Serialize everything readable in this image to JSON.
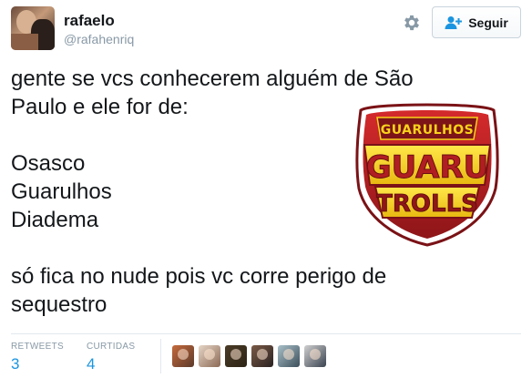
{
  "header": {
    "fullname": "rafaelo",
    "username": "@rafahenriq",
    "follow_label": "Seguir"
  },
  "tweet": {
    "text": "gente se vcs conhecerem alguém de São\nPaulo e ele for de:\n\nOsasco\nGuarulhos\nDiadema\n\nsó fica no nude pois vc corre perigo de\nsequestro"
  },
  "logo": {
    "top_text": "GUARULHOS",
    "mid_text": "GUARU",
    "bottom_text": "TROLLS"
  },
  "stats": {
    "retweets_label": "RETWEETS",
    "retweets_value": "3",
    "favorites_label": "CURTIDAS",
    "favorites_value": "4"
  },
  "icons": {
    "settings": "gear-icon",
    "follow": "add-user-icon"
  },
  "colors": {
    "link_blue": "#1b95e0",
    "muted": "#8899a6",
    "logo_red": "#b01e22",
    "logo_yellow": "#f7d21b"
  }
}
